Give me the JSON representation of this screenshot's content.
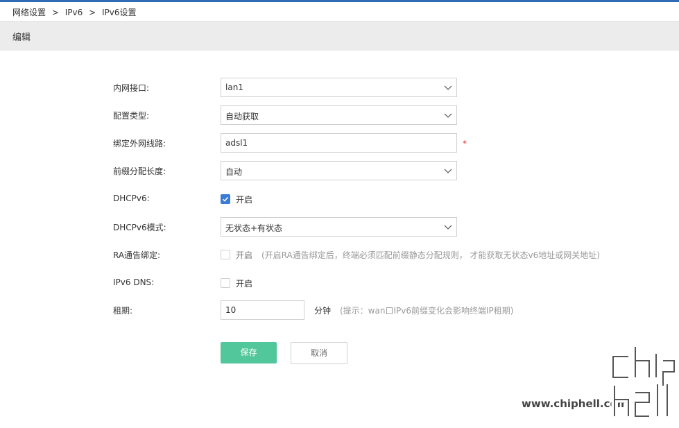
{
  "breadcrumb": {
    "items": [
      "网络设置",
      "IPv6",
      "IPv6设置"
    ],
    "sep": ">"
  },
  "header": {
    "title": "编辑"
  },
  "form": {
    "lan_interface": {
      "label": "内网接口:",
      "value": "lan1"
    },
    "config_type": {
      "label": "配置类型:",
      "value": "自动获取"
    },
    "bind_wan": {
      "label": "绑定外网线路:",
      "value": "adsl1",
      "required": "*"
    },
    "prefix_length": {
      "label": "前缀分配长度:",
      "value": "自动"
    },
    "dhcpv6": {
      "label": "DHCPv6:",
      "checkbox_label": "开启",
      "checked": true
    },
    "dhcpv6_mode": {
      "label": "DHCPv6模式:",
      "value": "无状态+有状态"
    },
    "ra_bind": {
      "label": "RA通告绑定:",
      "checkbox_label": "开启",
      "checked": false,
      "hint": "(开启RA通告绑定后，终端必须匹配前缀静态分配规则， 才能获取无状态v6地址或网关地址)"
    },
    "ipv6_dns": {
      "label": "IPv6 DNS:",
      "checkbox_label": "开启",
      "checked": false
    },
    "lease": {
      "label": "租期:",
      "value": "10",
      "unit": "分钟",
      "hint": "(提示：wan口IPv6前缀变化会影响终端IP租期)"
    }
  },
  "buttons": {
    "save": "保存",
    "cancel": "取消"
  },
  "watermark": {
    "url": "www.chiphell.com"
  },
  "colors": {
    "accent": "#2f6cb3",
    "save": "#52c79c",
    "checkbox": "#3a7bd5",
    "required": "#e4393c"
  }
}
